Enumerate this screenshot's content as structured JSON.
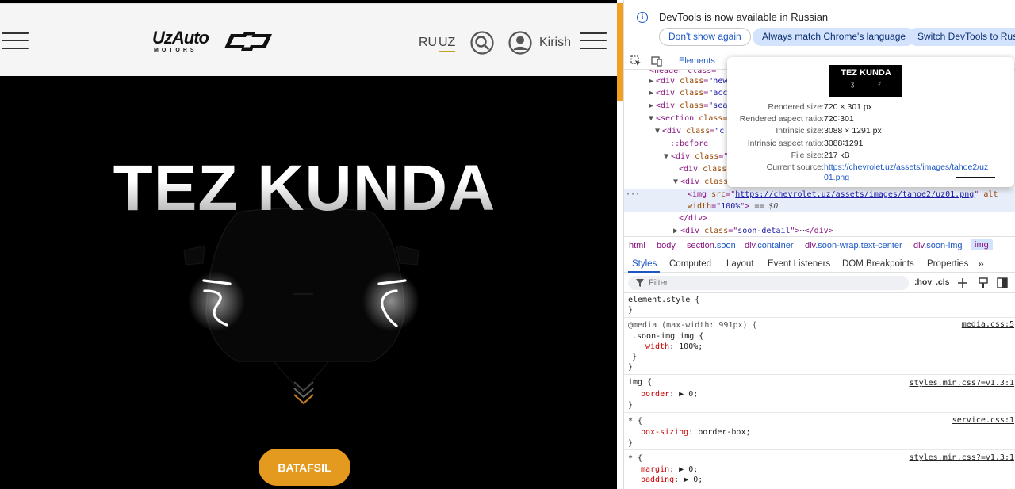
{
  "site": {
    "logo": {
      "main": "UzAuto",
      "sub": "MOTORS"
    },
    "header": {
      "lang_ru": "RU",
      "lang_uz": "UZ",
      "login": "Kirish"
    },
    "hero": {
      "title": "TEZ KUNDA",
      "cta": "BATAFSIL"
    }
  },
  "devtools": {
    "infobar": {
      "message": "DevTools is now available in Russian",
      "btn_dont_show": "Don't show again",
      "btn_match": "Always match Chrome's language",
      "btn_switch": "Switch DevTools to Russi"
    },
    "toolbar": {
      "elements_tab": "Elements"
    },
    "dom": {
      "line_new": "new",
      "line_acc": "acc",
      "line_sea": "sea",
      "line_section": "section",
      "line_div_c": "c",
      "pseudo_before": "::before",
      "img_src": "https://chevrolet.uz/assets/images/tahoe2/uz01.png",
      "img_width": "100%",
      "eq0": "== $0",
      "soon_detail": "soon-detail"
    },
    "tooltip": {
      "thumb_title": "TEZ KUNDA",
      "rows": [
        {
          "key": "Rendered size:",
          "value": "720 × 301 px"
        },
        {
          "key": "Rendered aspect ratio:",
          "value": "720∶301"
        },
        {
          "key": "Intrinsic size:",
          "value": "3088 × 1291 px"
        },
        {
          "key": "Intrinsic aspect ratio:",
          "value": "3088∶1291"
        },
        {
          "key": "File size:",
          "value": "217 kB"
        },
        {
          "key": "Current source:",
          "value": "https://chevrolet.uz/assets/images/tahoe2/uz"
        }
      ],
      "source_cont": "01.png"
    },
    "breadcrumbs": [
      {
        "tag": "html",
        "cls": ""
      },
      {
        "tag": "body",
        "cls": ""
      },
      {
        "tag": "section",
        "cls": ".soon"
      },
      {
        "tag": "div",
        "cls": ".container"
      },
      {
        "tag": "div",
        "cls": ".soon-wrap.text-center"
      },
      {
        "tag": "div",
        "cls": ".soon-img"
      },
      {
        "tag": "img",
        "cls": ""
      }
    ],
    "sub_tabs": [
      "Styles",
      "Computed",
      "Layout",
      "Event Listeners",
      "DOM Breakpoints",
      "Properties"
    ],
    "filter": {
      "placeholder": "Filter",
      "hov": ":hov",
      "cls": ".cls"
    },
    "styles": {
      "element_style": "element.style {",
      "close": "}",
      "media_query": "@media (max-width: 991px) {",
      "media_src": "media.css:5",
      "soon_img_sel": ".soon-img img {",
      "width_prop": "width",
      "width_val": "100%;",
      "img_sel": "img {",
      "img_src": "styles.min.css?=v1.3:1",
      "border_prop": "border",
      "border_val": "0;",
      "star_sel": "* {",
      "service_src": "service.css:1",
      "box_prop": "box-sizing",
      "box_val": "border-box;",
      "star_src2": "styles.min.css?=v1.3:1",
      "margin_prop": "margin",
      "margin_val": "0;",
      "padding_prop": "padding",
      "padding_val": "0;"
    }
  }
}
